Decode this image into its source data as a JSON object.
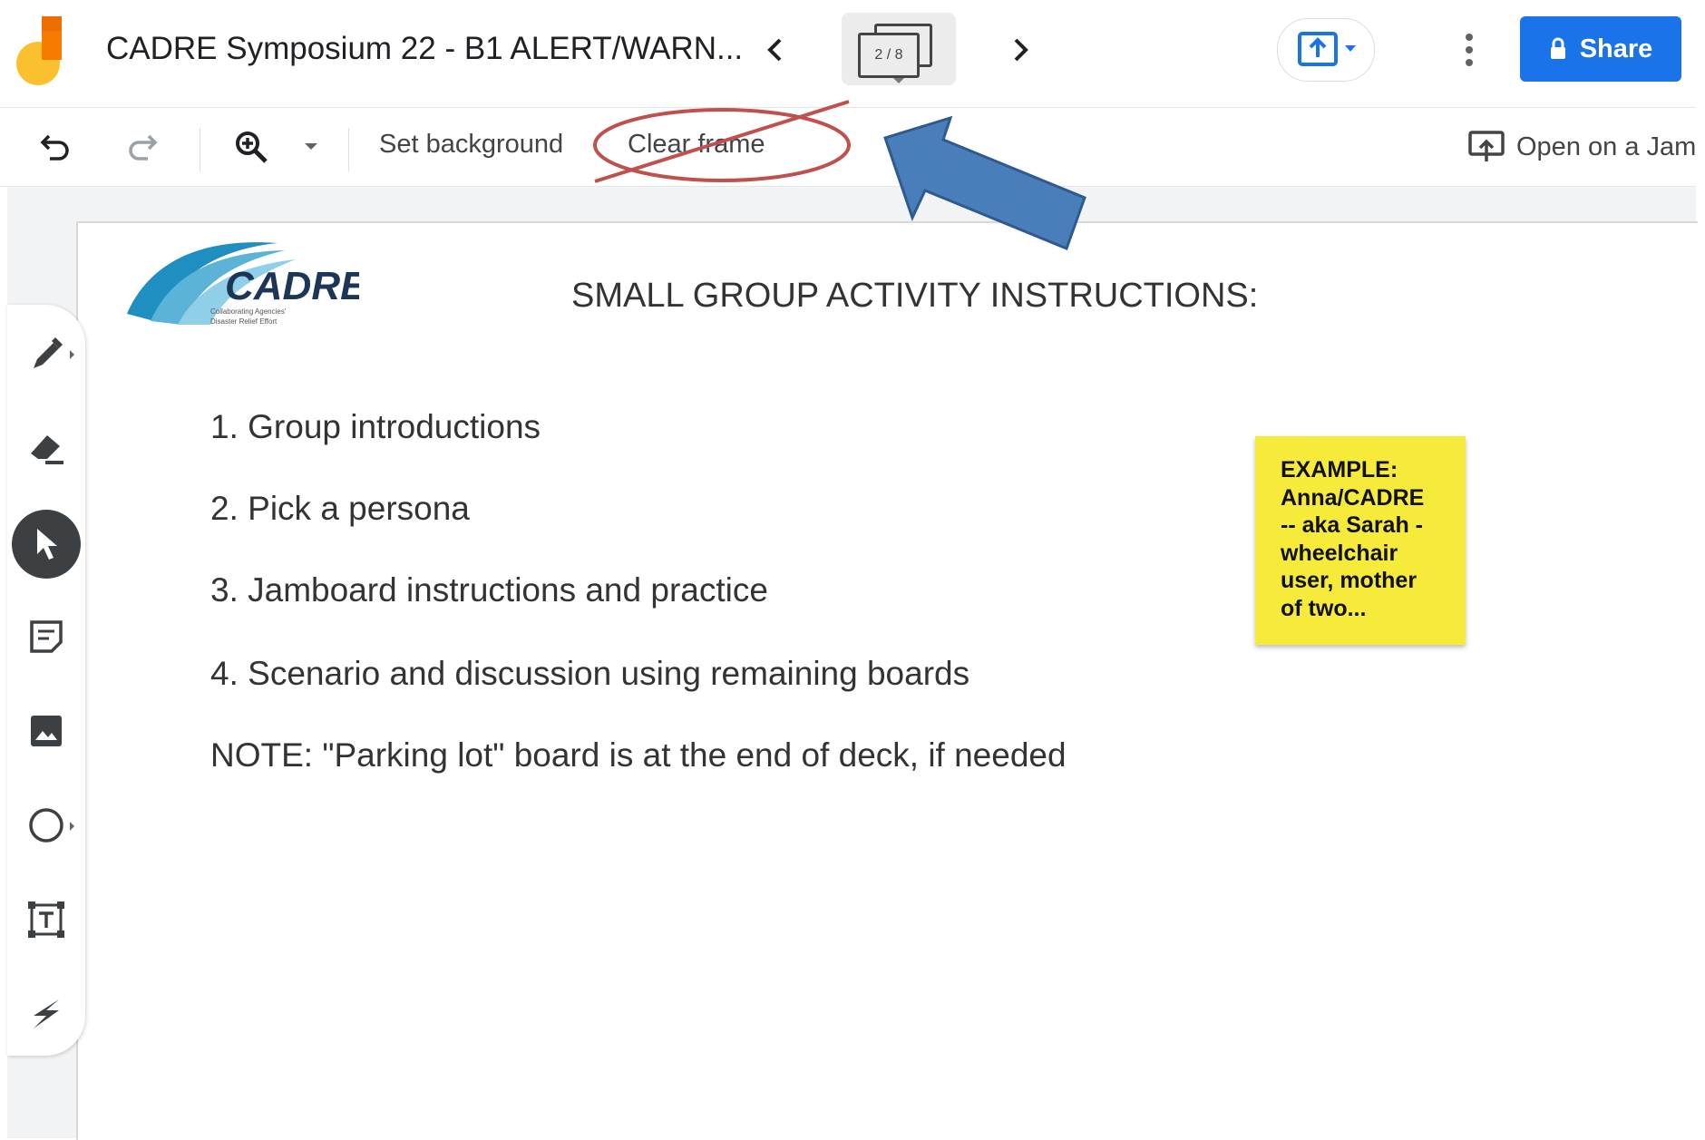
{
  "header": {
    "title": "CADRE Symposium 22 - B1 ALERT/WARN...",
    "frame_counter": "2 / 8",
    "share_label": "Share"
  },
  "toolbar": {
    "set_background": "Set background",
    "clear_frame": "Clear frame",
    "open_on_jamboard": "Open on a Jam"
  },
  "slide": {
    "logo_text": "CADRE",
    "logo_tagline_1": "Collaborating Agencies'",
    "logo_tagline_2": "Disaster Relief Effort",
    "title": "SMALL GROUP ACTIVITY INSTRUCTIONS:",
    "items": [
      "1. Group introductions",
      "2. Pick a persona",
      "3. Jamboard instructions and practice",
      "4. Scenario and discussion using remaining boards",
      "NOTE: \"Parking lot\" board is at the end of deck, if needed"
    ],
    "sticky_note": {
      "lines": [
        "EXAMPLE:",
        "Anna/CADRE",
        "-- aka Sarah -",
        "wheelchair",
        "user, mother",
        "of two..."
      ],
      "color": "#f6ea3a"
    }
  },
  "tools": [
    {
      "name": "pen-tool",
      "icon": "pen-icon"
    },
    {
      "name": "eraser-tool",
      "icon": "eraser-icon"
    },
    {
      "name": "select-tool",
      "icon": "pointer-icon",
      "active": true
    },
    {
      "name": "sticky-note-tool",
      "icon": "sticky-note-icon"
    },
    {
      "name": "image-tool",
      "icon": "image-icon"
    },
    {
      "name": "shape-tool",
      "icon": "circle-icon"
    },
    {
      "name": "text-box-tool",
      "icon": "text-box-icon"
    },
    {
      "name": "laser-tool",
      "icon": "laser-icon"
    }
  ],
  "colors": {
    "accent": "#1a73e8",
    "annotation_arrow": "#4a7ebb",
    "annotation_circle": "#c0504d"
  }
}
